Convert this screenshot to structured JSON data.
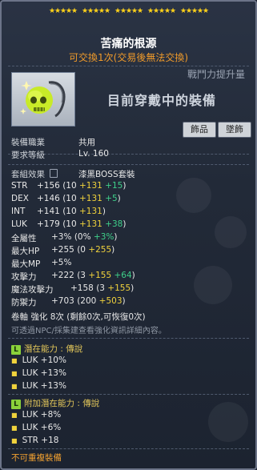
{
  "stars": [
    "★",
    "★",
    "★",
    "★",
    "★",
    "★",
    "★",
    "★",
    "★",
    "★",
    "★",
    "★",
    "★",
    "★",
    "★",
    "★",
    "★",
    "★",
    "★",
    "★",
    "★",
    "★",
    "★",
    "★",
    "★"
  ],
  "item": {
    "name": "苦痛的根源",
    "trade_note": "可交換1次(交易後無法交換)",
    "power_label": "戰鬥力提升量",
    "equipped_note": "目前穿戴中的裝備",
    "tags": [
      "飾品",
      "墜飾"
    ]
  },
  "requirements": {
    "job_label": "裝備職業",
    "job_value": "共用",
    "level_label": "要求等級",
    "level_value": "Lv. 160"
  },
  "set": {
    "label": "套組效果",
    "value": "漆黑BOSS套裝"
  },
  "stats": {
    "str": {
      "name": "STR",
      "total": "+156",
      "base": "(10",
      "scroll": "+131",
      "extra": "+15",
      "close": ")"
    },
    "dex": {
      "name": "DEX",
      "total": "+146",
      "base": "(10",
      "scroll": "+131",
      "extra": "+5",
      "close": ")"
    },
    "int": {
      "name": "INT",
      "total": "+141",
      "base": "(10",
      "scroll": "+131",
      "close": ")"
    },
    "luk": {
      "name": "LUK",
      "total": "+179",
      "base": "(10",
      "scroll": "+131",
      "extra": "+38",
      "close": ")"
    },
    "all": {
      "name": "全屬性",
      "total": "+3%",
      "base": "(0%",
      "extra": "+3%",
      "close": ")"
    },
    "maxhp": {
      "name": "最大HP",
      "total": "+255",
      "base": "(0",
      "scroll": "+255",
      "close": ")"
    },
    "maxmp": {
      "name": "最大MP",
      "total": "+5%"
    },
    "att": {
      "name": "攻擊力",
      "total": "+222",
      "base": "(3",
      "scroll": "+155",
      "extra": "+64",
      "close": ")"
    },
    "matt": {
      "name": "魔法攻擊力",
      "total": "+158",
      "base": "(3",
      "scroll": "+155",
      "close": ")"
    },
    "def": {
      "name": "防禦力",
      "total": "+703",
      "base": "(200",
      "scroll": "+503",
      "close": ")"
    }
  },
  "upgrade": {
    "label": "卷軸 強化",
    "value": "8次",
    "detail": "(剩餘0次,可恢復0次)",
    "hint": "可透過NPC/採集建查看強化資訊詳細內容。"
  },
  "potential": {
    "badge": "L",
    "label": "潛在能力",
    "sep": ":",
    "grade": "傳說",
    "lines": [
      "LUK +10%",
      "LUK +13%",
      "LUK +13%"
    ]
  },
  "bonus_potential": {
    "badge": "L",
    "label": "附加潛在能力",
    "sep": ":",
    "grade": "傳說",
    "lines": [
      "LUK +8%",
      "LUK +6%",
      "STR +18"
    ]
  },
  "footer": "不可重複裝備"
}
